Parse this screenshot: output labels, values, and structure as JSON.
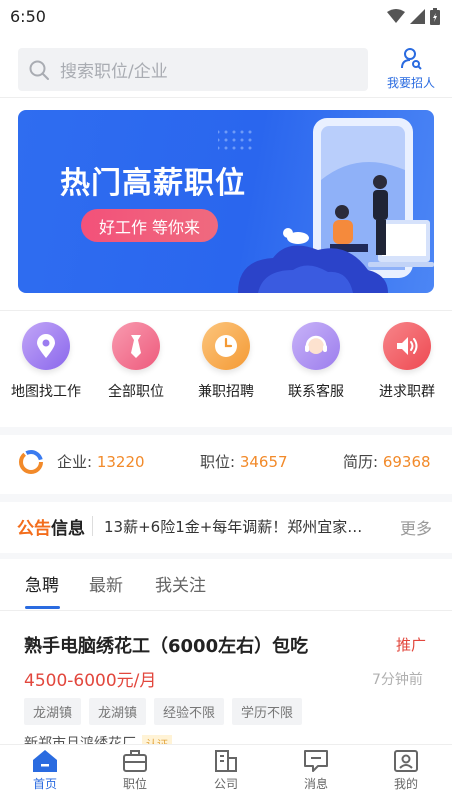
{
  "status_bar": {
    "time": "6:50"
  },
  "search": {
    "placeholder": "搜索职位/企业",
    "recruit_label": "我要招人"
  },
  "banner": {
    "title": "热门高薪职位",
    "slogan": "好工作 等你来"
  },
  "quick_entries": [
    {
      "label": "地图找工作",
      "icon": "map-pin-icon",
      "color": "#9b7cf0"
    },
    {
      "label": "全部职位",
      "icon": "tie-icon",
      "color": "#f06584"
    },
    {
      "label": "兼职招聘",
      "icon": "clock-icon",
      "color": "#f7a94a"
    },
    {
      "label": "联系客服",
      "icon": "headset-icon",
      "color": "#a889f0"
    },
    {
      "label": "进求职群",
      "icon": "speaker-icon",
      "color": "#f2575e"
    }
  ],
  "stats": {
    "company_label": "企业:",
    "company_value": "13220",
    "job_label": "职位:",
    "job_value": "34657",
    "resume_label": "简历:",
    "resume_value": "69368"
  },
  "notice": {
    "logo_part1": "公告",
    "logo_part2": "信息",
    "text": "13薪+6险1金+每年调薪！郑州宜家…",
    "more": "更多"
  },
  "tabs": [
    {
      "label": "急聘"
    },
    {
      "label": "最新"
    },
    {
      "label": "我关注"
    }
  ],
  "job": {
    "title": "熟手电脑绣花工（6000左右）包吃",
    "badge": "推广",
    "salary": "4500-6000元/月",
    "time": "7分钟前",
    "tags": [
      "龙湖镇",
      "龙湖镇",
      "经验不限",
      "学历不限"
    ],
    "company": "新郑市且鸿绣花厂",
    "company_badge": "认证"
  },
  "bottom_nav": [
    {
      "label": "首页",
      "icon": "home-icon"
    },
    {
      "label": "职位",
      "icon": "briefcase-icon"
    },
    {
      "label": "公司",
      "icon": "building-icon"
    },
    {
      "label": "消息",
      "icon": "message-icon"
    },
    {
      "label": "我的",
      "icon": "profile-icon"
    }
  ],
  "colors": {
    "accent": "#2a6be0",
    "salary": "#e2473d",
    "stat": "#f28a2a"
  }
}
